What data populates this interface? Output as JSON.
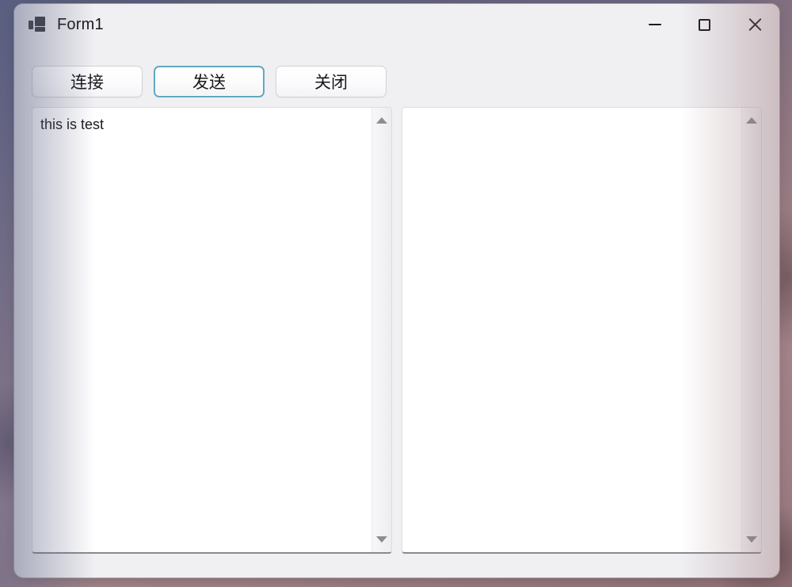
{
  "window": {
    "title": "Form1",
    "icon": "winforms-app-icon",
    "controls": {
      "minimize_label": "—",
      "maximize_label": "□",
      "close_label": "✕"
    }
  },
  "toolbar": {
    "buttons": [
      {
        "label": "连接",
        "name": "connect-button",
        "focused": false
      },
      {
        "label": "发送",
        "name": "send-button",
        "focused": true
      },
      {
        "label": "关闭",
        "name": "close-button",
        "focused": false
      }
    ]
  },
  "panes": {
    "left": {
      "value": "this is test",
      "placeholder": "",
      "scrollbar": {
        "up": "scroll-up-arrow",
        "down": "scroll-down-arrow"
      }
    },
    "right": {
      "value": "",
      "placeholder": "",
      "scrollbar": {
        "up": "scroll-up-arrow",
        "down": "scroll-down-arrow"
      }
    }
  },
  "colors": {
    "window_background": "#f0eff2",
    "textbox_background": "#ffffff",
    "focus_border": "#62a8bf",
    "button_border": "#d2d2d6",
    "text": "#17171a",
    "scrollbar_arrow": "#8d8d91",
    "desktop_tint": "#9a8189"
  }
}
